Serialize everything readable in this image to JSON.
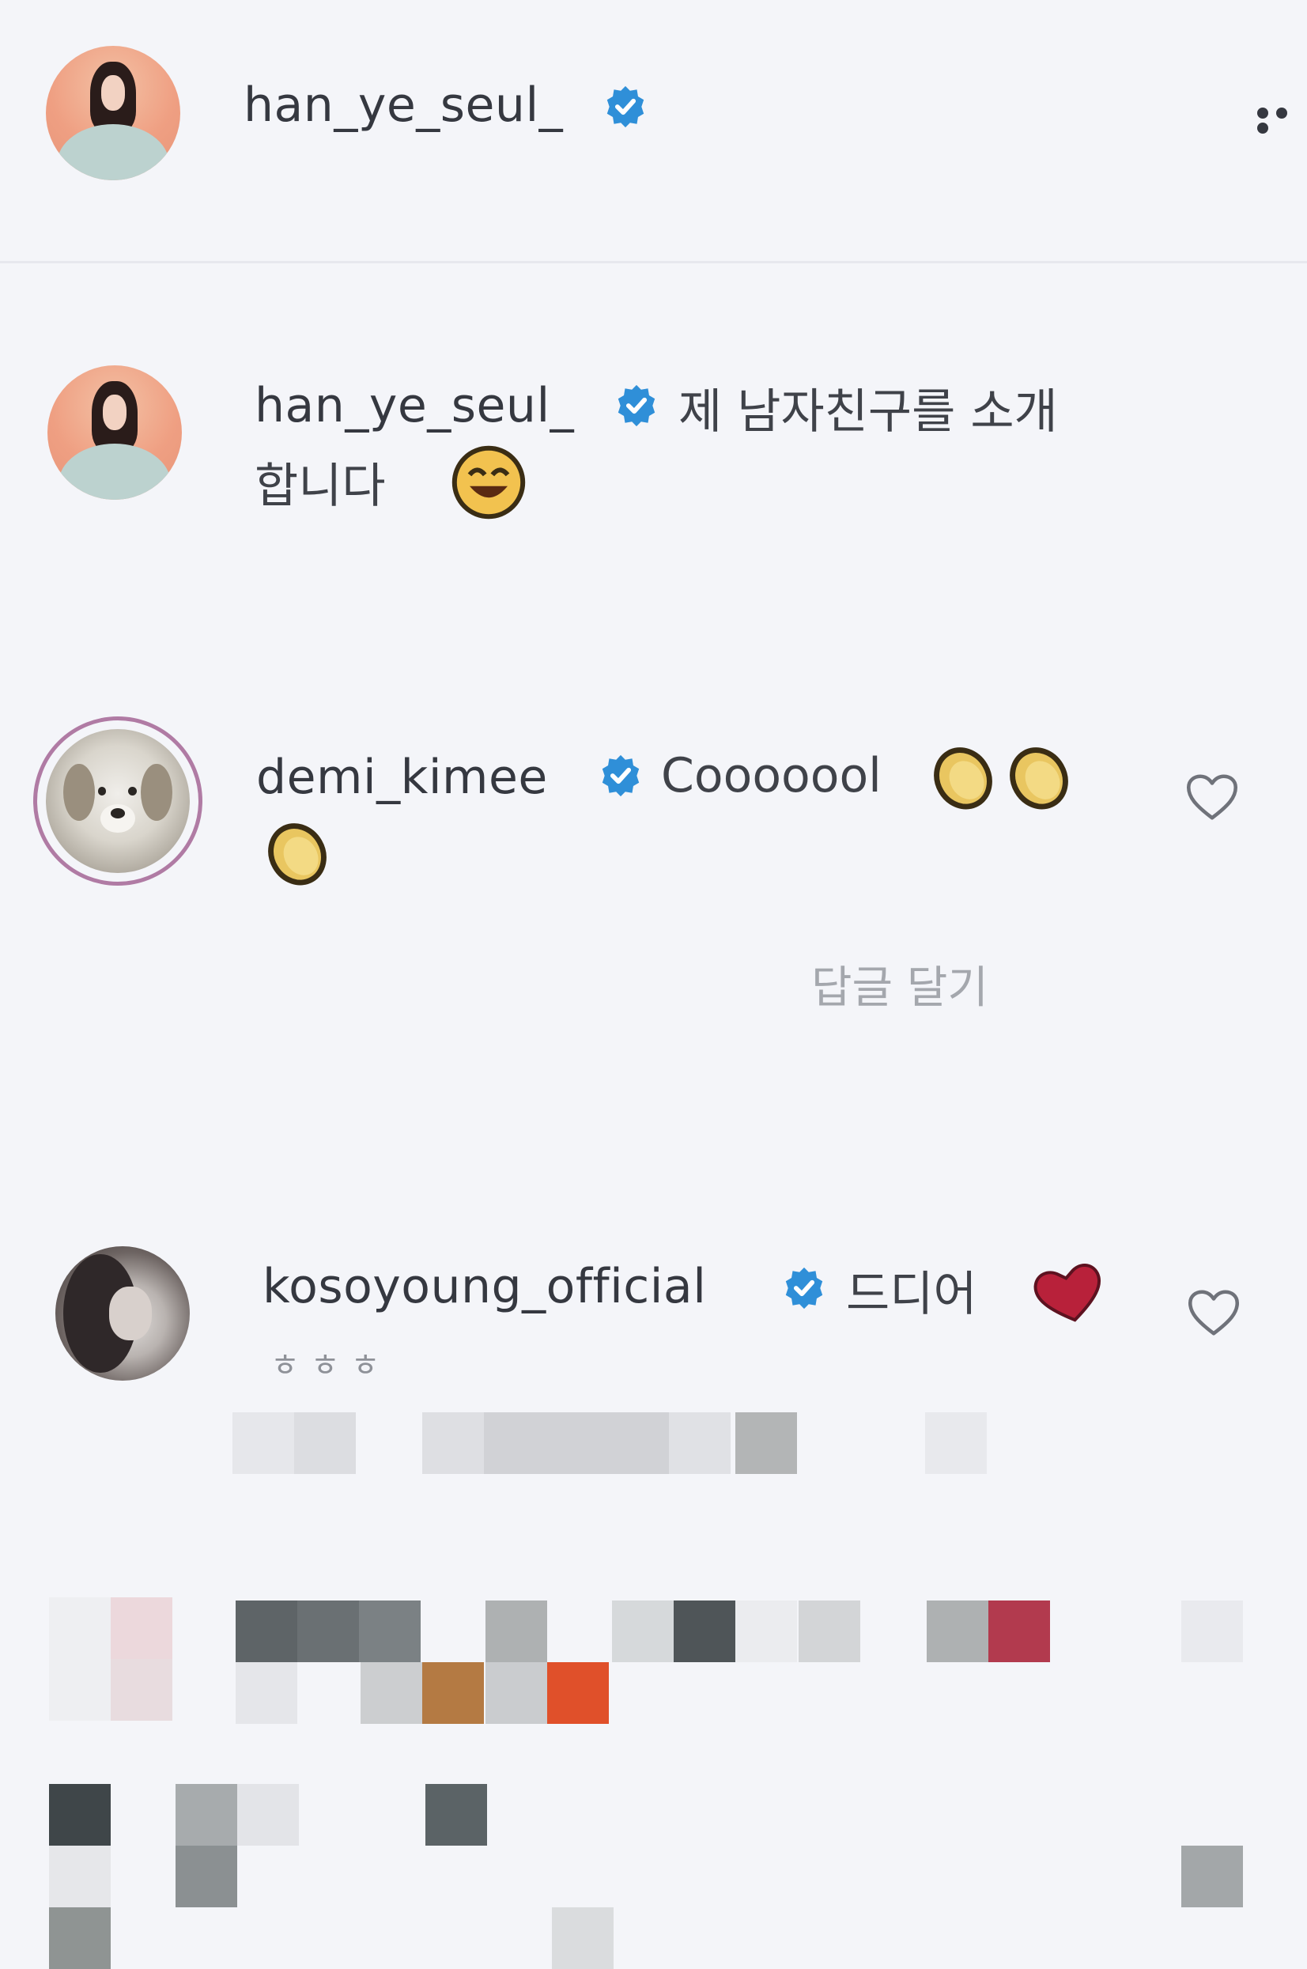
{
  "post_header": {
    "username": "han_ye_seul_",
    "verified": true,
    "more_icon": "more-horizontal-icon"
  },
  "comments": [
    {
      "username": "han_ye_seul_",
      "verified": true,
      "text_line1": "제 남자친구를 소개",
      "text_line2": "합니다",
      "emoji": "smiling-face-emoji"
    },
    {
      "username": "demi_kimee",
      "verified": true,
      "text": "Cooooool",
      "emojis": [
        "clapping-hands-emoji",
        "clapping-hands-emoji",
        "clapping-hands-emoji"
      ],
      "reply_label": "답글 달기",
      "like_icon": "heart-icon"
    },
    {
      "username": "kosoyoung_official",
      "verified": true,
      "text": "드디어",
      "emoji": "red-heart-emoji",
      "subtext": "ㅎㅎㅎ",
      "like_icon": "heart-icon"
    }
  ],
  "colors": {
    "background": "#f4f5f9",
    "verified_blue": "#2f8fd8",
    "text": "#353840",
    "muted": "#a4a7ad"
  }
}
